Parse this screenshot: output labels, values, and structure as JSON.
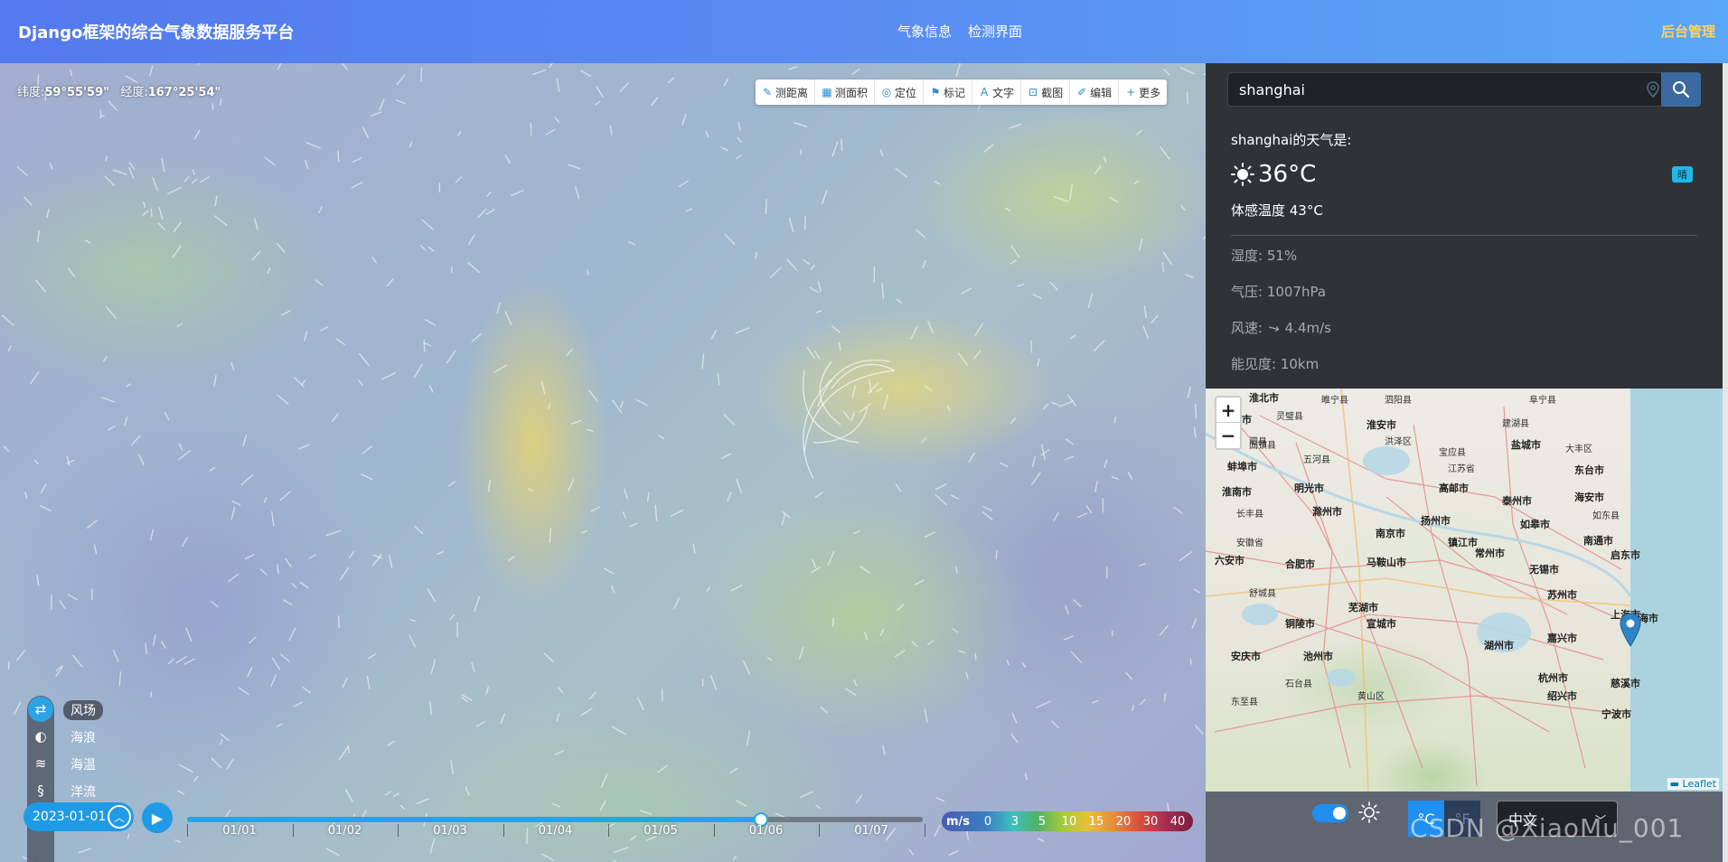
{
  "header": {
    "title": "Django框架的综合气象数据服务平台",
    "nav": [
      "气象信息",
      "检测界面"
    ],
    "admin": "后台管理"
  },
  "map": {
    "coords": {
      "lat_label": "纬度:",
      "lat_value": "59°55'59\"",
      "lon_label": "经度:",
      "lon_value": "167°25'54\""
    },
    "toolbar": [
      {
        "label": "测距离",
        "icon": "ruler-icon"
      },
      {
        "label": "测面积",
        "icon": "area-icon"
      },
      {
        "label": "定位",
        "icon": "location-icon"
      },
      {
        "label": "标记",
        "icon": "flag-icon"
      },
      {
        "label": "文字",
        "icon": "text-icon"
      },
      {
        "label": "截图",
        "icon": "crop-icon"
      },
      {
        "label": "编辑",
        "icon": "edit-icon"
      },
      {
        "label": "更多",
        "icon": "plus-icon"
      }
    ],
    "layers": [
      {
        "label": "风场",
        "icon": "wind-icon",
        "active": true
      },
      {
        "label": "海浪",
        "icon": "wave-icon",
        "active": false
      },
      {
        "label": "海温",
        "icon": "sea-temp-icon",
        "active": false
      },
      {
        "label": "洋流",
        "icon": "current-icon",
        "active": false
      }
    ],
    "timeline": {
      "date": "2023-01-01",
      "ticks": [
        "01/01",
        "01/02",
        "01/03",
        "01/04",
        "01/05",
        "01/06",
        "01/07"
      ],
      "progress": 0.78
    },
    "legend": {
      "unit": "m/s",
      "values": [
        "0",
        "3",
        "5",
        "10",
        "15",
        "20",
        "30",
        "40"
      ]
    }
  },
  "panel": {
    "search": {
      "value": "shanghai",
      "placeholder": ""
    },
    "weather": {
      "title": "shanghai的天气是:",
      "temp": "36°C",
      "condition": "晴",
      "feels": "体感温度 43°C",
      "humidity": "湿度: 51%",
      "pressure": "气压: 1007hPa",
      "wind_label": "风速:",
      "wind_value": "4.4m/s",
      "visibility": "能见度: 10km"
    },
    "minimap": {
      "attribution": "Leaflet",
      "labels": [
        {
          "t": "淮北市"
        },
        {
          "t": "睢宁县"
        },
        {
          "t": "泗阳县"
        },
        {
          "t": "阜宁县"
        },
        {
          "t": "宿州市"
        },
        {
          "t": "灵璧县"
        },
        {
          "t": "淮安市"
        },
        {
          "t": "建湖县"
        },
        {
          "t": "泗县"
        },
        {
          "t": "洪泽区"
        },
        {
          "t": "盐城市"
        },
        {
          "t": "固镇县"
        },
        {
          "t": "五河县"
        },
        {
          "t": "宝应县"
        },
        {
          "t": "大丰区"
        },
        {
          "t": "蚌埠市"
        },
        {
          "t": "江苏省"
        },
        {
          "t": "东台市"
        },
        {
          "t": "淮南市"
        },
        {
          "t": "明光市"
        },
        {
          "t": "高邮市"
        },
        {
          "t": "泰州市"
        },
        {
          "t": "海安市"
        },
        {
          "t": "长丰县"
        },
        {
          "t": "滁州市"
        },
        {
          "t": "扬州市"
        },
        {
          "t": "如皋市"
        },
        {
          "t": "如东县"
        },
        {
          "t": "安徽省"
        },
        {
          "t": "南京市"
        },
        {
          "t": "镇江市"
        },
        {
          "t": "南通市"
        },
        {
          "t": "六安市"
        },
        {
          "t": "合肥市"
        },
        {
          "t": "马鞍山市"
        },
        {
          "t": "常州市"
        },
        {
          "t": "无锡市"
        },
        {
          "t": "启东市"
        },
        {
          "t": "舒城县"
        },
        {
          "t": "芜湖市"
        },
        {
          "t": "苏州市"
        },
        {
          "t": "上海市"
        },
        {
          "t": "铜陵市"
        },
        {
          "t": "宣城市"
        },
        {
          "t": "湖州市"
        },
        {
          "t": "嘉兴市"
        },
        {
          "t": "安庆市"
        },
        {
          "t": "池州市"
        },
        {
          "t": "杭州市"
        },
        {
          "t": "绍兴市"
        },
        {
          "t": "宁波市"
        },
        {
          "t": "石台县"
        },
        {
          "t": "黄山区"
        },
        {
          "t": "慈溪市"
        },
        {
          "t": "东至县"
        },
        {
          "t": "上海市"
        }
      ]
    },
    "controls": {
      "unit_c": "°C",
      "unit_f": "°F",
      "language": "中文"
    }
  },
  "watermark": "CSDN @XiaoMu_001"
}
